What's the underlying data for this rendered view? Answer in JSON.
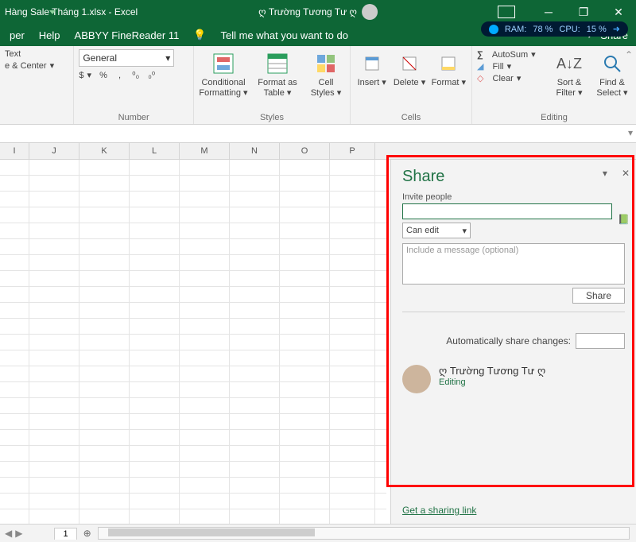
{
  "title": {
    "filename": "Hàng Sale Tháng 1.xlsx  -  Excel",
    "user": "ღ Trường Tương Tư ღ"
  },
  "tabs": {
    "per": "per",
    "help": "Help",
    "abbyy": "ABBYY FineReader 11",
    "tellme": "Tell me what you want to do",
    "share": "Share"
  },
  "sysmon": {
    "ram_lbl": "RAM:",
    "ram_val": "78 %",
    "cpu_lbl": "CPU:",
    "cpu_val": "15 %"
  },
  "ribbon": {
    "align": {
      "wrap": "Text",
      "merge": "e & Center"
    },
    "number": {
      "label": "Number",
      "format": "General",
      "cur": "$",
      "pct": "%",
      "comma": ",",
      "inc": ".0",
      "dec": ".00"
    },
    "styles": {
      "label": "Styles",
      "cf": "Conditional Formatting ▾",
      "fat": "Format as Table ▾",
      "cs": "Cell Styles ▾"
    },
    "cells": {
      "label": "Cells",
      "ins": "Insert ▾",
      "del": "Delete ▾",
      "fmt": "Format ▾"
    },
    "editing": {
      "label": "Editing",
      "sum": "AutoSum",
      "fill": "Fill",
      "clear": "Clear",
      "sort": "Sort & Filter ▾",
      "find": "Find & Select ▾"
    }
  },
  "cols": [
    "I",
    "J",
    "K",
    "L",
    "M",
    "N",
    "O",
    "P"
  ],
  "share_pane": {
    "title": "Share",
    "invite_lbl": "Invite people",
    "perm": "Can edit",
    "msg_ph": "Include a message (optional)",
    "btn": "Share",
    "auto_lbl": "Automatically share changes:",
    "person_name": "ღ Trường Tương Tư ღ",
    "person_status": "Editing",
    "link": "Get a sharing link"
  },
  "sheet": {
    "name": "1"
  }
}
